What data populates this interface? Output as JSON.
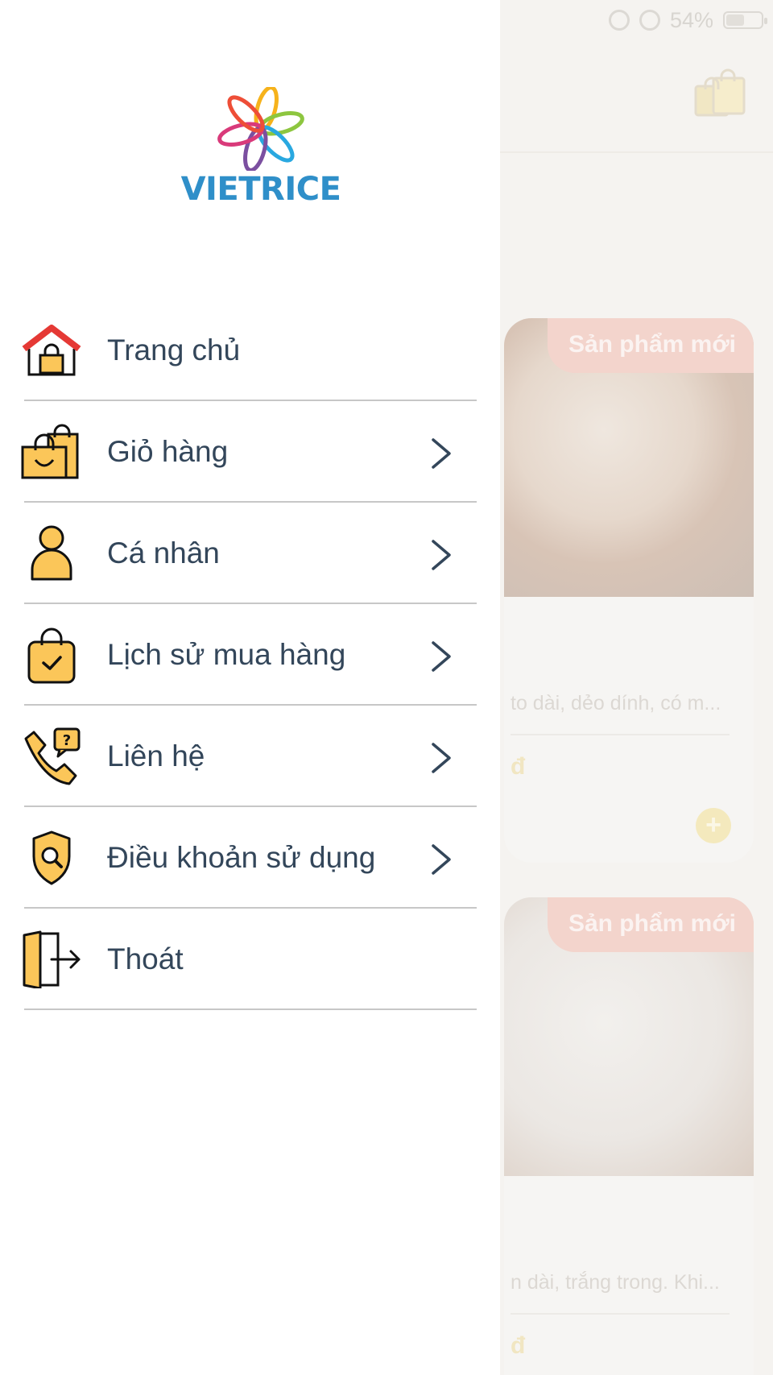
{
  "status_bar": {
    "battery": "54%"
  },
  "background": {
    "cards": [
      {
        "badge": "Sản phẩm mới",
        "description": "to dài, dẻo dính, có m...",
        "price": "đ",
        "add_button": "+"
      },
      {
        "badge": "Sản phẩm mới",
        "description": "n dài, trắng trong. Khi...",
        "price": "đ"
      }
    ]
  },
  "drawer": {
    "logo_text": "VIETRICE",
    "menu": [
      {
        "label": "Trang chủ",
        "icon": "home-icon",
        "chevron": false
      },
      {
        "label": "Giỏ hàng",
        "icon": "shopping-bags-icon",
        "chevron": true
      },
      {
        "label": "Cá nhân",
        "icon": "user-icon",
        "chevron": true
      },
      {
        "label": "Lịch sử mua hàng",
        "icon": "bag-check-icon",
        "chevron": true
      },
      {
        "label": "Liên hệ",
        "icon": "phone-help-icon",
        "chevron": true
      },
      {
        "label": "Điều khoản sử dụng",
        "icon": "shield-search-icon",
        "chevron": true
      },
      {
        "label": "Thoát",
        "icon": "exit-door-icon",
        "chevron": false
      }
    ]
  },
  "colors": {
    "icon_yellow": "#fbc659",
    "text": "#33465a",
    "separator": "#c7c7c7",
    "logo_blue": "#2f8fc9"
  }
}
